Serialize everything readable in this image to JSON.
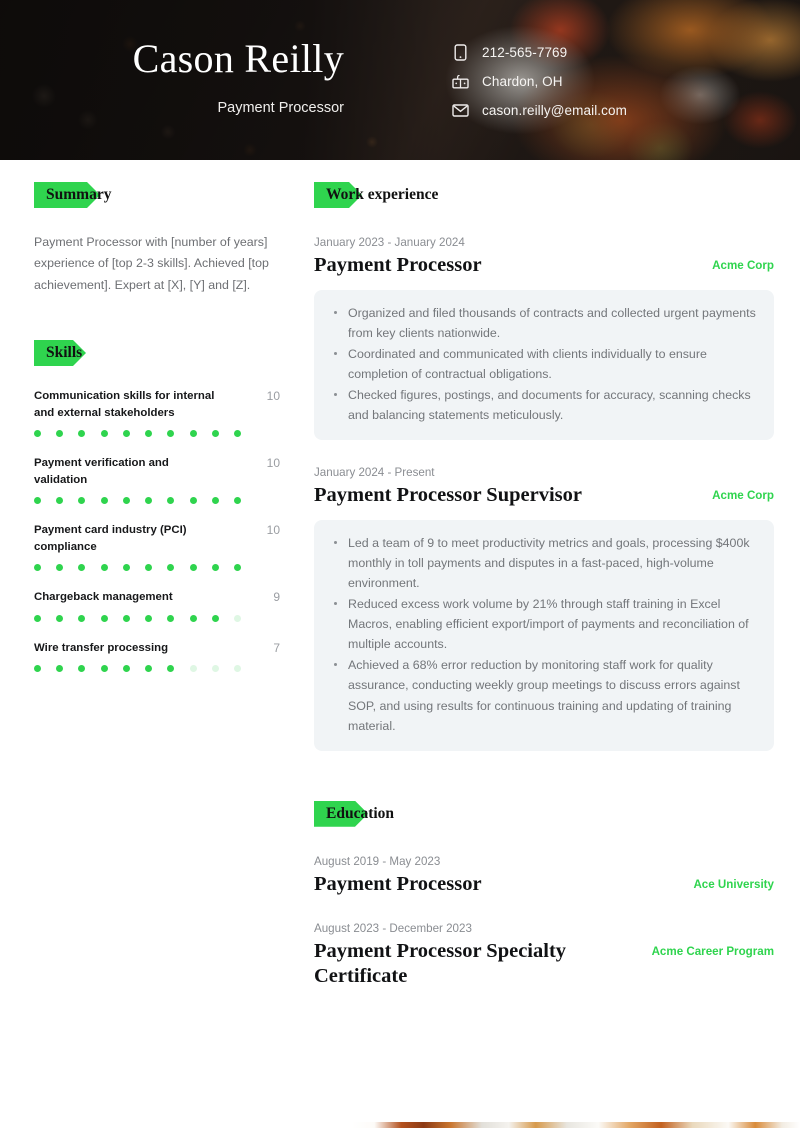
{
  "header": {
    "name": "Cason Reilly",
    "subtitle": "Payment Processor",
    "contacts": [
      {
        "icon": "phone-icon",
        "value": "212-565-7769"
      },
      {
        "icon": "location-icon",
        "value": "Chardon, OH"
      },
      {
        "icon": "email-icon",
        "value": "cason.reilly@email.com"
      }
    ]
  },
  "sections": {
    "summary_title": "Summary",
    "skills_title": "Skills",
    "work_title": "Work experience",
    "education_title": "Education"
  },
  "summary": {
    "text": "Payment Processor with [number of years] experience of [top 2-3 skills]. Achieved [top achievement]. Expert at [X], [Y] and [Z]."
  },
  "skills": [
    {
      "name": "Communication skills for internal and external stakeholders",
      "score": 10,
      "max": 10
    },
    {
      "name": "Payment verification and validation",
      "score": 10,
      "max": 10
    },
    {
      "name": "Payment card industry (PCI) compliance",
      "score": 10,
      "max": 10
    },
    {
      "name": "Chargeback management",
      "score": 9,
      "max": 10
    },
    {
      "name": "Wire transfer processing",
      "score": 7,
      "max": 10
    }
  ],
  "work_experience": [
    {
      "date": "January 2023 - January 2024",
      "title": "Payment Processor",
      "organization": "Acme Corp",
      "bullets": [
        "Organized and filed thousands of contracts and collected urgent payments from key clients nationwide.",
        "Coordinated and communicated with clients individually to ensure completion of contractual obligations.",
        "Checked figures, postings, and documents for accuracy, scanning checks and balancing statements meticulously."
      ]
    },
    {
      "date": "January 2024 - Present",
      "title": "Payment Processor Supervisor",
      "organization": "Acme Corp",
      "bullets": [
        "Led a team of 9 to meet productivity metrics and goals, processing $400k monthly in toll payments and disputes in a fast-paced, high-volume environment.",
        "Reduced excess work volume by 21% through staff training in Excel Macros, enabling efficient export/import of payments and reconciliation of multiple accounts.",
        "Achieved a 68% error reduction by monitoring staff work for quality assurance, conducting weekly group meetings to discuss errors against SOP, and using results for continuous training and updating of training material."
      ]
    }
  ],
  "education": [
    {
      "date": "August 2019 - May 2023",
      "title": "Payment Processor",
      "organization": "Ace University"
    },
    {
      "date": "August 2023 - December 2023",
      "title": "Payment Processor Specialty Certificate",
      "organization": "Acme Career Program"
    }
  ],
  "colors": {
    "accent_green": "#2fd44e",
    "dot_off": "#dff7e4",
    "card_bg": "#f1f4f6",
    "body_text": "#73767a"
  }
}
